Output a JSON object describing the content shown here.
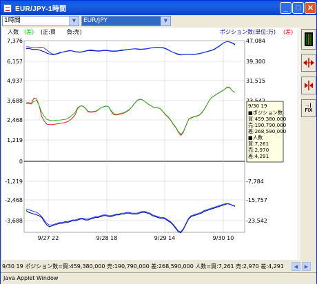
{
  "window": {
    "title": "EUR/JPY-1時間"
  },
  "controls": {
    "period": "1時間",
    "pair": "EUR/JPY"
  },
  "legend": {
    "left_title": "人数",
    "left_diff": "(差)",
    "sign_note": "(正:買　　負:売)",
    "right_title": "ポジション数(単位:万)",
    "right_diff": "(差)"
  },
  "left_axis_ticks": [
    "7,376",
    "6,157",
    "4,937",
    "3,688",
    "2,468",
    "1,219",
    "0",
    "-1,219",
    "-2,468",
    "-3,688"
  ],
  "right_axis_ticks": [
    "47,084",
    "39,300",
    "31,515",
    "23,542",
    "-7,784",
    "-15,757",
    "-23,542"
  ],
  "x_axis_ticks": [
    "9/27 22",
    "9/28 18",
    "9/29 14",
    "9/30 10"
  ],
  "tooltip": {
    "date": "9/30 19",
    "pos_header": "■ポジション数",
    "pos_buy": "買:459,380,000",
    "pos_sell": "売:190,790,000",
    "pos_diff": "差:268,590,000",
    "ppl_header": "■人数",
    "ppl_buy": "買:7,261",
    "ppl_sell": "売:2,970",
    "ppl_diff": "差:4,291"
  },
  "status_text": "9/30 19  ポジション数=買:459,380,000 売:190,790,000 差:268,590,000 人数=買:7,261 売:2,970 差:4,291",
  "footer": "Java Applet Window",
  "colors": {
    "series_dark": "#000080",
    "series_blue": "#2040ff",
    "series_red": "#e02020",
    "series_green": "#20c020",
    "legend_red": "#ff0000",
    "legend_green": "#00c000"
  },
  "chart_data": {
    "type": "line",
    "x": [
      0,
      1,
      2,
      3,
      4,
      5,
      6,
      7,
      8,
      9,
      10,
      11,
      12,
      13,
      14,
      15,
      16,
      17,
      18,
      19,
      20,
      21,
      22,
      23,
      24,
      25,
      26,
      27,
      28,
      29,
      30,
      31,
      32,
      33,
      34,
      35,
      36,
      37,
      38,
      39,
      40,
      41,
      42,
      43,
      44,
      45,
      46,
      47,
      48,
      49,
      50,
      51,
      52,
      53,
      54,
      55,
      56,
      57,
      58,
      59,
      60,
      61,
      62,
      63,
      64,
      65,
      66,
      67,
      68,
      69,
      70,
      71,
      72,
      73,
      74,
      75,
      76,
      77,
      78,
      79,
      80,
      81
    ],
    "series": [
      {
        "values": [
          6900,
          6920,
          6880,
          6850,
          6860,
          6830,
          6780,
          6720,
          6640,
          6590,
          6550,
          6560,
          6600,
          6650,
          6700,
          6740,
          6770,
          6800,
          6760,
          6720,
          6700,
          6690,
          6720,
          6760,
          6790,
          6800,
          6780,
          6770,
          6760,
          6770,
          6790,
          6800,
          6780,
          6760,
          6750,
          6760,
          6780,
          6800,
          6820,
          6840,
          6870,
          6880,
          6900,
          6880,
          6860,
          6870,
          6880,
          6900,
          6930,
          6960,
          6980,
          6990,
          6980,
          6970,
          6920,
          6850,
          6760,
          6690,
          6620,
          6560,
          6530,
          6550,
          6560,
          6570,
          6560,
          6560,
          6580,
          6600,
          6640,
          6680,
          6720,
          6760,
          6800,
          6860,
          6960,
          7060,
          7180,
          7280,
          7330,
          7300,
          7240,
          7160
        ]
      },
      {
        "values": [
          7020,
          7010,
          6980,
          6960,
          6960,
          6980,
          7000,
          6940,
          6820,
          6700,
          6600,
          6580,
          6620,
          6680,
          6700,
          6720,
          6760,
          6780,
          6780,
          6740,
          6720,
          6710,
          6740,
          6780,
          6810,
          6830,
          6810,
          6790,
          6780,
          6790,
          6810,
          6820,
          6800,
          6780,
          6770,
          6780,
          6800,
          6830,
          6840,
          6850,
          6860,
          6880,
          6900,
          6900,
          6880,
          6880,
          6900,
          6910,
          6940,
          6970,
          6980,
          6980,
          6970,
          6950,
          6900,
          6830,
          6750,
          6690,
          6640,
          6590,
          6550,
          6560,
          6570,
          6580,
          6570,
          6570,
          6590,
          6620,
          6650,
          6690,
          6730,
          6780,
          6820,
          6880,
          6980,
          7080,
          7190,
          7280,
          7330,
          7290,
          7220,
          7120
        ]
      },
      {
        "values": [
          3550,
          3560,
          3520,
          3850,
          3810,
          3400,
          2700,
          2400,
          2200,
          2180,
          2180,
          2200,
          2220,
          2250,
          2280,
          2300,
          2360,
          2450,
          2600,
          2800,
          3200,
          3350,
          3330,
          3200,
          2980,
          2950,
          2970,
          3000,
          3100,
          3240,
          3300,
          3350,
          3300,
          3000,
          2800,
          2780,
          2820,
          2850,
          2900,
          3000,
          3100,
          3300,
          3500,
          3700,
          3780,
          3750,
          3650,
          3500,
          3400,
          3300,
          3250,
          3230,
          3180,
          3000,
          2800,
          2650,
          2450,
          2200,
          2000,
          1700,
          1500,
          1700,
          2100,
          2500,
          2600,
          2650,
          2700,
          2750,
          2900,
          3100,
          3400,
          3700,
          3900,
          4000,
          4100,
          4200,
          4300,
          4400,
          4550,
          4500,
          4300,
          4200
        ]
      },
      {
        "values": [
          3500,
          3500,
          3480,
          3650,
          3700,
          3400,
          2950,
          2700,
          2500,
          2450,
          2420,
          2430,
          2450,
          2460,
          2480,
          2500,
          2550,
          2650,
          2800,
          2950,
          3250,
          3350,
          3350,
          3220,
          3020,
          2990,
          3000,
          3030,
          3120,
          3240,
          3300,
          3340,
          3300,
          3050,
          2860,
          2830,
          2860,
          2890,
          2930,
          3030,
          3130,
          3310,
          3500,
          3680,
          3760,
          3740,
          3650,
          3510,
          3410,
          3310,
          3260,
          3240,
          3190,
          3020,
          2830,
          2680,
          2480,
          2230,
          2030,
          1750,
          1560,
          1750,
          2130,
          2520,
          2620,
          2670,
          2720,
          2770,
          2920,
          3120,
          3410,
          3690,
          3890,
          3990,
          4090,
          4190,
          4290,
          4390,
          4520,
          4480,
          4300,
          4200
        ]
      },
      {
        "values": [
          -3100,
          -3200,
          -3250,
          -3300,
          -3350,
          -3400,
          -3500,
          -3750,
          -3950,
          -4050,
          -4000,
          -3950,
          -3900,
          -3850,
          -3850,
          -3800,
          -3800,
          -3750,
          -3700,
          -3700,
          -3650,
          -3600,
          -3600,
          -3650,
          -3650,
          -3600,
          -3550,
          -3500,
          -3500,
          -3450,
          -3400,
          -3400,
          -3450,
          -3450,
          -3400,
          -3350,
          -3350,
          -3300,
          -3300,
          -3250,
          -3250,
          -3300,
          -3300,
          -3300,
          -3250,
          -3200,
          -3200,
          -3250,
          -3300,
          -3400,
          -3450,
          -3500,
          -3550,
          -3550,
          -3600,
          -3700,
          -3800,
          -3950,
          -4150,
          -4350,
          -4400,
          -4200,
          -3900,
          -3600,
          -3450,
          -3400,
          -3350,
          -3300,
          -3250,
          -3150,
          -3100,
          -3050,
          -3000,
          -2950,
          -2900,
          -2850,
          -2800,
          -2750,
          -2700,
          -2720,
          -2800,
          -2850
        ]
      },
      {
        "values": [
          -3000,
          -3050,
          -3100,
          -3150,
          -3200,
          -3300,
          -3450,
          -3650,
          -3850,
          -3950,
          -3950,
          -3900,
          -3850,
          -3800,
          -3800,
          -3750,
          -3750,
          -3700,
          -3650,
          -3650,
          -3600,
          -3550,
          -3550,
          -3600,
          -3600,
          -3550,
          -3500,
          -3450,
          -3450,
          -3400,
          -3350,
          -3350,
          -3400,
          -3400,
          -3350,
          -3300,
          -3300,
          -3250,
          -3250,
          -3200,
          -3200,
          -3250,
          -3250,
          -3250,
          -3200,
          -3150,
          -3150,
          -3200,
          -3250,
          -3350,
          -3400,
          -3450,
          -3500,
          -3500,
          -3550,
          -3650,
          -3750,
          -3900,
          -4100,
          -4300,
          -4350,
          -4150,
          -3850,
          -3550,
          -3400,
          -3350,
          -3300,
          -3250,
          -3200,
          -3100,
          -3050,
          -3000,
          -2950,
          -2900,
          -2850,
          -2800,
          -2750,
          -2700,
          -2680,
          -2700,
          -2780,
          -2830
        ]
      }
    ],
    "ylim": [
      -4200,
      7600
    ],
    "grid": true
  }
}
